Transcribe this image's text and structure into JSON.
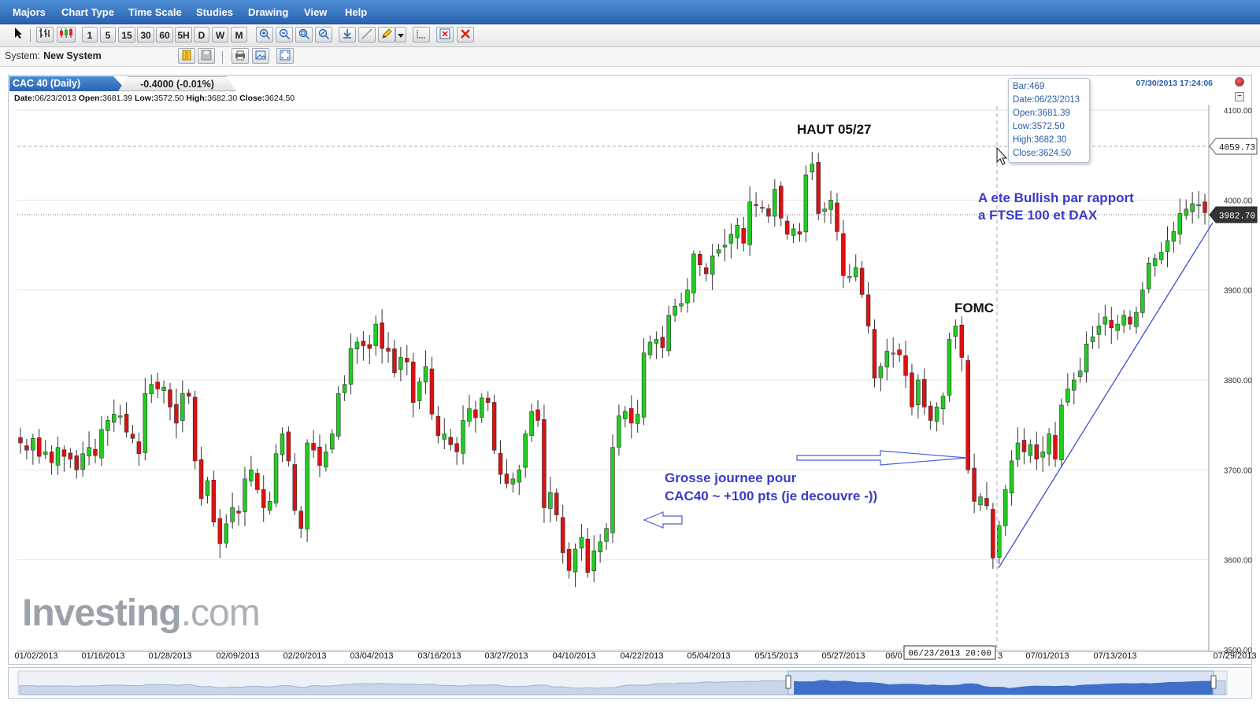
{
  "menu": {
    "items": [
      "Majors",
      "Chart Type",
      "Time Scale",
      "Studies",
      "Drawing",
      "View",
      "Help"
    ]
  },
  "toolbar": {
    "intervals": [
      "1",
      "5",
      "15",
      "30",
      "60",
      "5H",
      "D",
      "W",
      "M"
    ]
  },
  "system": {
    "label": "System:",
    "value": "New System"
  },
  "instrument": {
    "name": "CAC 40 (Daily)",
    "change": "-0.4000 (-0.01%)",
    "timestamp": "07/30/2013 17:24:06"
  },
  "ohlc_header": {
    "date_label": "Date:",
    "date": "06/23/2013",
    "open_label": "Open:",
    "open": "3681.39",
    "low_label": "Low:",
    "low": "3572.50",
    "high_label": "High:",
    "high": "3682.30",
    "close_label": "Close:",
    "close": "3624.50"
  },
  "tooltip": {
    "bar_label": "Bar:",
    "bar": "469",
    "date_label": "Date:",
    "date": "06/23/2013",
    "open_label": "Open:",
    "open": "3681.39",
    "low_label": "Low:",
    "low": "3572.50",
    "high_label": "High:",
    "high": "3682.30",
    "close_label": "Close:",
    "close": "3624.50"
  },
  "annotations": {
    "haut": "HAUT 05/27",
    "fomc": "FOMC",
    "bullish_line1": "A ete Bullish par rapport",
    "bullish_line2": "a FTSE 100 et DAX",
    "grosse_line1": "Grosse journee pour",
    "grosse_line2": "CAC40 ~ +100 pts (je decouvre -))"
  },
  "logo": {
    "main": "Investing",
    "suffix": ".com"
  },
  "price_tags": {
    "high": "4059.73",
    "last": "3982.70"
  },
  "crosshair_label": "06/23/2013 20:00",
  "colors": {
    "up": "#22cc22",
    "down": "#dd1111",
    "annotation_blue": "#3a3ac8",
    "trend_line": "#3a4fd0",
    "menubar": "#2a62b0"
  },
  "chart_data": {
    "type": "candlestick",
    "ylim": [
      3500,
      4100
    ],
    "y_ticks": [
      "4100.00",
      "4000.00",
      "3900.00",
      "3800.00",
      "3700.00",
      "3600.00",
      "3500.00"
    ],
    "x_ticks": [
      "01/02/2013",
      "01/16/2013",
      "01/28/2013",
      "02/09/2013",
      "02/20/2013",
      "03/04/2013",
      "03/16/2013",
      "03/27/2013",
      "04/10/2013",
      "04/22/2013",
      "05/04/2013",
      "05/15/2013",
      "05/27/2013",
      "06/0",
      "3",
      "07/01/2013",
      "07/13/2013",
      "07/29/2013"
    ],
    "closes": [
      3730,
      3722,
      3735,
      3715,
      3720,
      3708,
      3725,
      3715,
      3712,
      3700,
      3718,
      3725,
      3716,
      3745,
      3755,
      3762,
      3760,
      3742,
      3735,
      3718,
      3785,
      3795,
      3790,
      3792,
      3770,
      3752,
      3785,
      3782,
      3710,
      3668,
      3688,
      3642,
      3618,
      3640,
      3658,
      3652,
      3690,
      3700,
      3678,
      3658,
      3665,
      3718,
      3740,
      3710,
      3655,
      3635,
      3730,
      3722,
      3705,
      3720,
      3740,
      3785,
      3795,
      3835,
      3842,
      3838,
      3835,
      3862,
      3835,
      3832,
      3808,
      3825,
      3820,
      3775,
      3798,
      3815,
      3762,
      3738,
      3740,
      3728,
      3720,
      3755,
      3768,
      3758,
      3780,
      3775,
      3722,
      3695,
      3685,
      3690,
      3700,
      3740,
      3765,
      3755,
      3658,
      3675,
      3650,
      3608,
      3588,
      3612,
      3625,
      3586,
      3610,
      3620,
      3635,
      3725,
      3760,
      3765,
      3752,
      3762,
      3830,
      3842,
      3845,
      3836,
      3872,
      3882,
      3885,
      3900,
      3940,
      3928,
      3918,
      3938,
      3945,
      3950,
      3962,
      3972,
      3952,
      3998,
      3995,
      3992,
      3982,
      4012,
      3980,
      3962,
      3968,
      3962,
      4028,
      4040,
      3985,
      3990,
      4000,
      3965,
      3916,
      3915,
      3925,
      3895,
      3860,
      3802,
      3815,
      3832,
      3830,
      3828,
      3805,
      3770,
      3800,
      3770,
      3755,
      3770,
      3782,
      3845,
      3860,
      3825,
      3700,
      3665,
      3670,
      3660,
      3602,
      3638,
      3678,
      3710,
      3730,
      3720,
      3728,
      3712,
      3720,
      3740,
      3712,
      3772,
      3790,
      3800,
      3810,
      3840,
      3848,
      3860,
      3870,
      3858,
      3862,
      3872,
      3862,
      3875,
      3900,
      3930,
      3935,
      3942,
      3955,
      3965,
      3985,
      3990,
      3996,
      3995,
      3986
    ]
  }
}
